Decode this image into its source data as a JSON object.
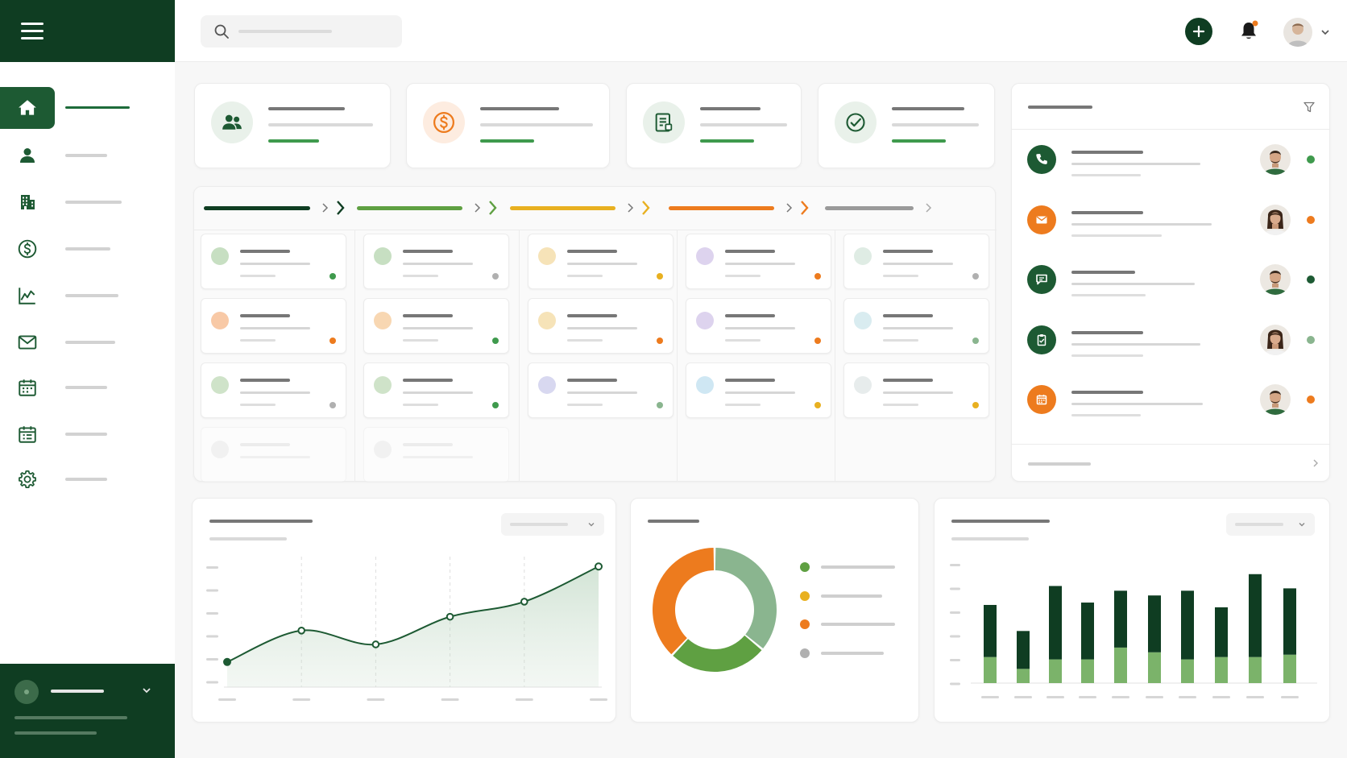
{
  "colors": {
    "brand_dark": "#0f3d22",
    "brand": "#1d5a33",
    "green_light": "#5fa042",
    "yellow": "#e8b020",
    "orange": "#ed7b1e",
    "gray": "#9a9a9a"
  },
  "topbar": {
    "search_icon": "search-icon",
    "add_icon": "plus-icon",
    "notification_icon": "bell-icon",
    "profile_icon": "avatar"
  },
  "sidebar": {
    "items": [
      {
        "icon": "home-icon",
        "active": true
      },
      {
        "icon": "person-icon",
        "active": false
      },
      {
        "icon": "building-icon",
        "active": false
      },
      {
        "icon": "dollar-icon",
        "active": false
      },
      {
        "icon": "chart-icon",
        "active": false
      },
      {
        "icon": "mail-icon",
        "active": false
      },
      {
        "icon": "calendar-icon",
        "active": false
      },
      {
        "icon": "calendar-list-icon",
        "active": false
      },
      {
        "icon": "gear-icon",
        "active": false
      }
    ]
  },
  "kpis": [
    {
      "icon": "users-icon",
      "accent": "#1d5a33"
    },
    {
      "icon": "dollar-icon",
      "accent": "#ed7b1e"
    },
    {
      "icon": "document-icon",
      "accent": "#1d5a33"
    },
    {
      "icon": "check-circle-icon",
      "accent": "#1d5a33"
    }
  ],
  "pipeline": {
    "stages": [
      {
        "color": "#0f3d22"
      },
      {
        "color": "#5fa042"
      },
      {
        "color": "#e8b020"
      },
      {
        "color": "#ed7b1e"
      },
      {
        "color": "#9a9a9a"
      }
    ],
    "deals": [
      [
        {
          "dot": "#c7dfc2",
          "status": "#3f9a4d"
        },
        {
          "dot": "#f8c9a6",
          "status": "#ed7b1e"
        },
        {
          "dot": "#cfe3c9",
          "status": "#b0b0b0"
        }
      ],
      [
        {
          "dot": "#c7dfc2",
          "status": "#b0b0b0"
        },
        {
          "dot": "#f8d7b2",
          "status": "#3f9a4d"
        },
        {
          "dot": "#cfe3c9",
          "status": "#3f9a4d"
        }
      ],
      [
        {
          "dot": "#f6e3b8",
          "status": "#e8b020"
        },
        {
          "dot": "#f6e3b8",
          "status": "#ed7b1e"
        },
        {
          "dot": "#d8d8f0",
          "status": "#8ab58f"
        }
      ],
      [
        {
          "dot": "#ddd3ee",
          "status": "#ed7b1e"
        },
        {
          "dot": "#ddd3ee",
          "status": "#ed7b1e"
        },
        {
          "dot": "#cfe7f3",
          "status": "#e8b020"
        }
      ],
      [
        {
          "dot": "#dfece4",
          "status": "#b0b0b0"
        },
        {
          "dot": "#d9ecf0",
          "status": "#8ab58f"
        },
        {
          "dot": "#e7ecec",
          "status": "#e8b020"
        }
      ]
    ]
  },
  "activities": [
    {
      "icon": "phone-icon",
      "color": "#1d5a33",
      "status": "#3f9a4d",
      "avatar": "male"
    },
    {
      "icon": "mail-icon",
      "color": "#ed7b1e",
      "status": "#ed7b1e",
      "avatar": "female"
    },
    {
      "icon": "chat-icon",
      "color": "#1d5a33",
      "status": "#1d5a33",
      "avatar": "male"
    },
    {
      "icon": "clipboard-icon",
      "color": "#1d5a33",
      "status": "#8ab58f",
      "avatar": "female"
    },
    {
      "icon": "calendar-icon",
      "color": "#ed7b1e",
      "status": "#ed7b1e",
      "avatar": "male"
    }
  ],
  "chart_data": [
    {
      "type": "area",
      "x": [
        1,
        2,
        3,
        4,
        5,
        6
      ],
      "values": [
        20,
        45,
        34,
        56,
        68,
        96
      ],
      "ylim": [
        0,
        100
      ],
      "grid": true,
      "color": "#1d5a33"
    },
    {
      "type": "pie",
      "donut": true,
      "values": [
        36,
        26,
        38
      ],
      "colors": [
        "#8ab58f",
        "#5fa042",
        "#ed7b1e"
      ],
      "legend_colors": [
        "#5fa042",
        "#e8b020",
        "#ed7b1e",
        "#b0b0b0"
      ],
      "legend_placement": "right"
    },
    {
      "type": "bar",
      "stacked": true,
      "x": [
        1,
        2,
        3,
        4,
        5,
        6,
        7,
        8,
        9,
        10
      ],
      "series": [
        {
          "values": [
            11,
            6,
            10,
            10,
            15,
            13,
            10,
            11,
            11,
            12
          ],
          "color": "#7bb36a"
        },
        {
          "values": [
            22,
            16,
            31,
            24,
            24,
            24,
            29,
            21,
            35,
            28
          ],
          "color": "#0f3d22"
        }
      ],
      "ylim": [
        0,
        50
      ],
      "grid": false
    }
  ]
}
